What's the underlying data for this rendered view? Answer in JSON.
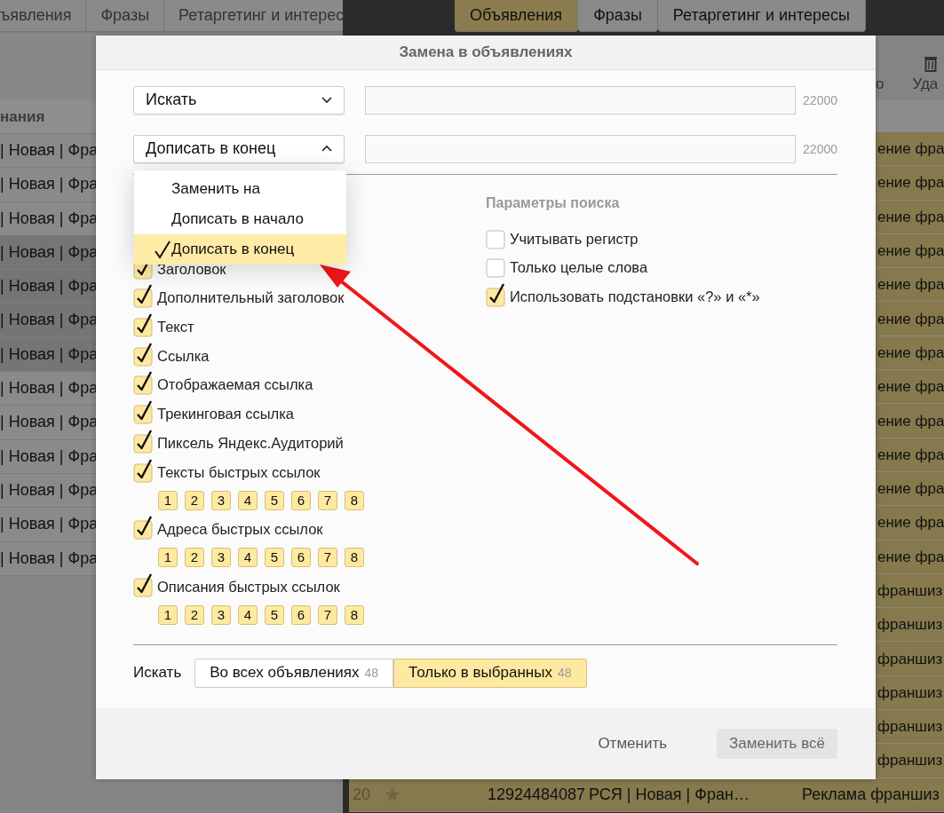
{
  "left_panel": {
    "tabs": [
      {
        "label": "ъявления",
        "selected": false
      },
      {
        "label": "Фразы",
        "selected": false
      },
      {
        "label": "Ретаргетинг и интерес",
        "selected": false
      }
    ],
    "column_header": "нания",
    "rows": [
      {
        "text": "| Новая | Фра",
        "selected": false
      },
      {
        "text": "| Новая | Фра",
        "selected": false
      },
      {
        "text": "| Новая | Фра",
        "selected": false
      },
      {
        "text": "| Новая | Фра",
        "selected": true
      },
      {
        "text": "| Новая | Фра",
        "selected": true
      },
      {
        "text": "| Новая | Фра",
        "selected": true
      },
      {
        "text": "| Новая | Фра",
        "selected": true
      },
      {
        "text": "| Новая | Фра",
        "selected": false
      },
      {
        "text": "| Новая | Фра",
        "selected": false
      },
      {
        "text": "| Новая | Фра",
        "selected": false
      },
      {
        "text": "| Новая | Фра",
        "selected": false
      },
      {
        "text": "| Новая | Фра",
        "selected": false
      },
      {
        "text": "| Новая | Фра",
        "selected": false
      }
    ]
  },
  "right_panel": {
    "tabs": [
      {
        "label": "Объявления",
        "selected": true
      },
      {
        "label": "Фразы",
        "selected": false
      },
      {
        "label": "Ретаргетинг и интересы",
        "selected": false
      }
    ],
    "toolbar": [
      {
        "kind": "text",
        "label": "о"
      },
      {
        "kind": "delete",
        "label": "Уда"
      }
    ],
    "rows": [
      {
        "text": "ение фра",
        "selected": true
      },
      {
        "text": "ение фра",
        "selected": true
      },
      {
        "text": "ение фра",
        "selected": true
      },
      {
        "text": "ение фра",
        "selected": true
      },
      {
        "text": "ение фра",
        "selected": true
      },
      {
        "text": "ение фра",
        "selected": true
      },
      {
        "text": "ение фра",
        "selected": true
      },
      {
        "text": "ение фра",
        "selected": true
      },
      {
        "text": "ение фра",
        "selected": true
      },
      {
        "text": "ение фра",
        "selected": true
      },
      {
        "text": "ение фра",
        "selected": true
      },
      {
        "text": "ение фра",
        "selected": true
      },
      {
        "text": "ение фра",
        "selected": true
      },
      {
        "text": "франшиз",
        "selected": true
      },
      {
        "text": "франшиз",
        "selected": true
      },
      {
        "text": "франшиз",
        "selected": true
      },
      {
        "text": "франшиз",
        "selected": true
      },
      {
        "text": "франшиз",
        "selected": true
      },
      {
        "text": "франшиз",
        "selected": true
      }
    ],
    "last_row": {
      "number": "20",
      "starred": false,
      "id": "12924484087",
      "campaign": "РСЯ | Новая | Фран…",
      "text": "Реклама франшиз",
      "selected": true
    }
  },
  "dialog": {
    "title": "Замена в объявлениях",
    "find_row": {
      "mode": "Искать",
      "expanded": false,
      "limit": "22000"
    },
    "action_row": {
      "mode": "Дописать в конец",
      "expanded": true,
      "limit": "22000"
    },
    "action_menu": [
      {
        "label": "Заменить на",
        "selected": false
      },
      {
        "label": "Дописать в начало",
        "selected": false
      },
      {
        "label": "Дописать в конец",
        "selected": true
      }
    ],
    "fields": [
      {
        "kind": "checkbox",
        "label": "Заголовок",
        "checked": true
      },
      {
        "kind": "checkbox",
        "label": "Дополнительный заголовок",
        "checked": true
      },
      {
        "kind": "checkbox",
        "label": "Текст",
        "checked": true
      },
      {
        "kind": "checkbox",
        "label": "Ссылка",
        "checked": true
      },
      {
        "kind": "checkbox",
        "label": "Отображаемая ссылка",
        "checked": true
      },
      {
        "kind": "checkbox",
        "label": "Трекинговая ссылка",
        "checked": true
      },
      {
        "kind": "checkbox",
        "label": "Пиксель Яндекс.Аудиторий",
        "checked": true
      },
      {
        "kind": "checkbox",
        "label": "Тексты быстрых ссылок",
        "checked": true
      },
      {
        "kind": "numbers",
        "items": [
          {
            "label": "1",
            "on": true
          },
          {
            "label": "2",
            "on": true
          },
          {
            "label": "3",
            "on": true
          },
          {
            "label": "4",
            "on": true
          },
          {
            "label": "5",
            "on": true
          },
          {
            "label": "6",
            "on": true
          },
          {
            "label": "7",
            "on": true
          },
          {
            "label": "8",
            "on": true
          }
        ]
      },
      {
        "kind": "checkbox",
        "label": "Адреса быстрых ссылок",
        "checked": true
      },
      {
        "kind": "numbers",
        "items": [
          {
            "label": "1",
            "on": true
          },
          {
            "label": "2",
            "on": true
          },
          {
            "label": "3",
            "on": true
          },
          {
            "label": "4",
            "on": true
          },
          {
            "label": "5",
            "on": true
          },
          {
            "label": "6",
            "on": true
          },
          {
            "label": "7",
            "on": true
          },
          {
            "label": "8",
            "on": true
          }
        ]
      },
      {
        "kind": "checkbox",
        "label": "Описания быстрых ссылок",
        "checked": true
      },
      {
        "kind": "numbers",
        "items": [
          {
            "label": "1",
            "on": true
          },
          {
            "label": "2",
            "on": true
          },
          {
            "label": "3",
            "on": true
          },
          {
            "label": "4",
            "on": true
          },
          {
            "label": "5",
            "on": true
          },
          {
            "label": "6",
            "on": true
          },
          {
            "label": "7",
            "on": true
          },
          {
            "label": "8",
            "on": true
          }
        ]
      }
    ],
    "search_params": {
      "title": "Параметры поиска",
      "options": [
        {
          "label": "Учитывать регистр",
          "checked": false
        },
        {
          "label": "Только целые слова",
          "checked": false
        },
        {
          "label": "Использовать подстановки «?» и «*»",
          "checked": true
        }
      ]
    },
    "scope": {
      "label": "Искать",
      "options": [
        {
          "label": "Во всех объявлениях",
          "count": "48",
          "selected": false
        },
        {
          "label": "Только в выбранных",
          "count": "48",
          "selected": true
        }
      ]
    },
    "buttons": [
      {
        "kind": "link",
        "label": "Отменить"
      },
      {
        "kind": "button",
        "label": "Заменить всё"
      }
    ]
  }
}
